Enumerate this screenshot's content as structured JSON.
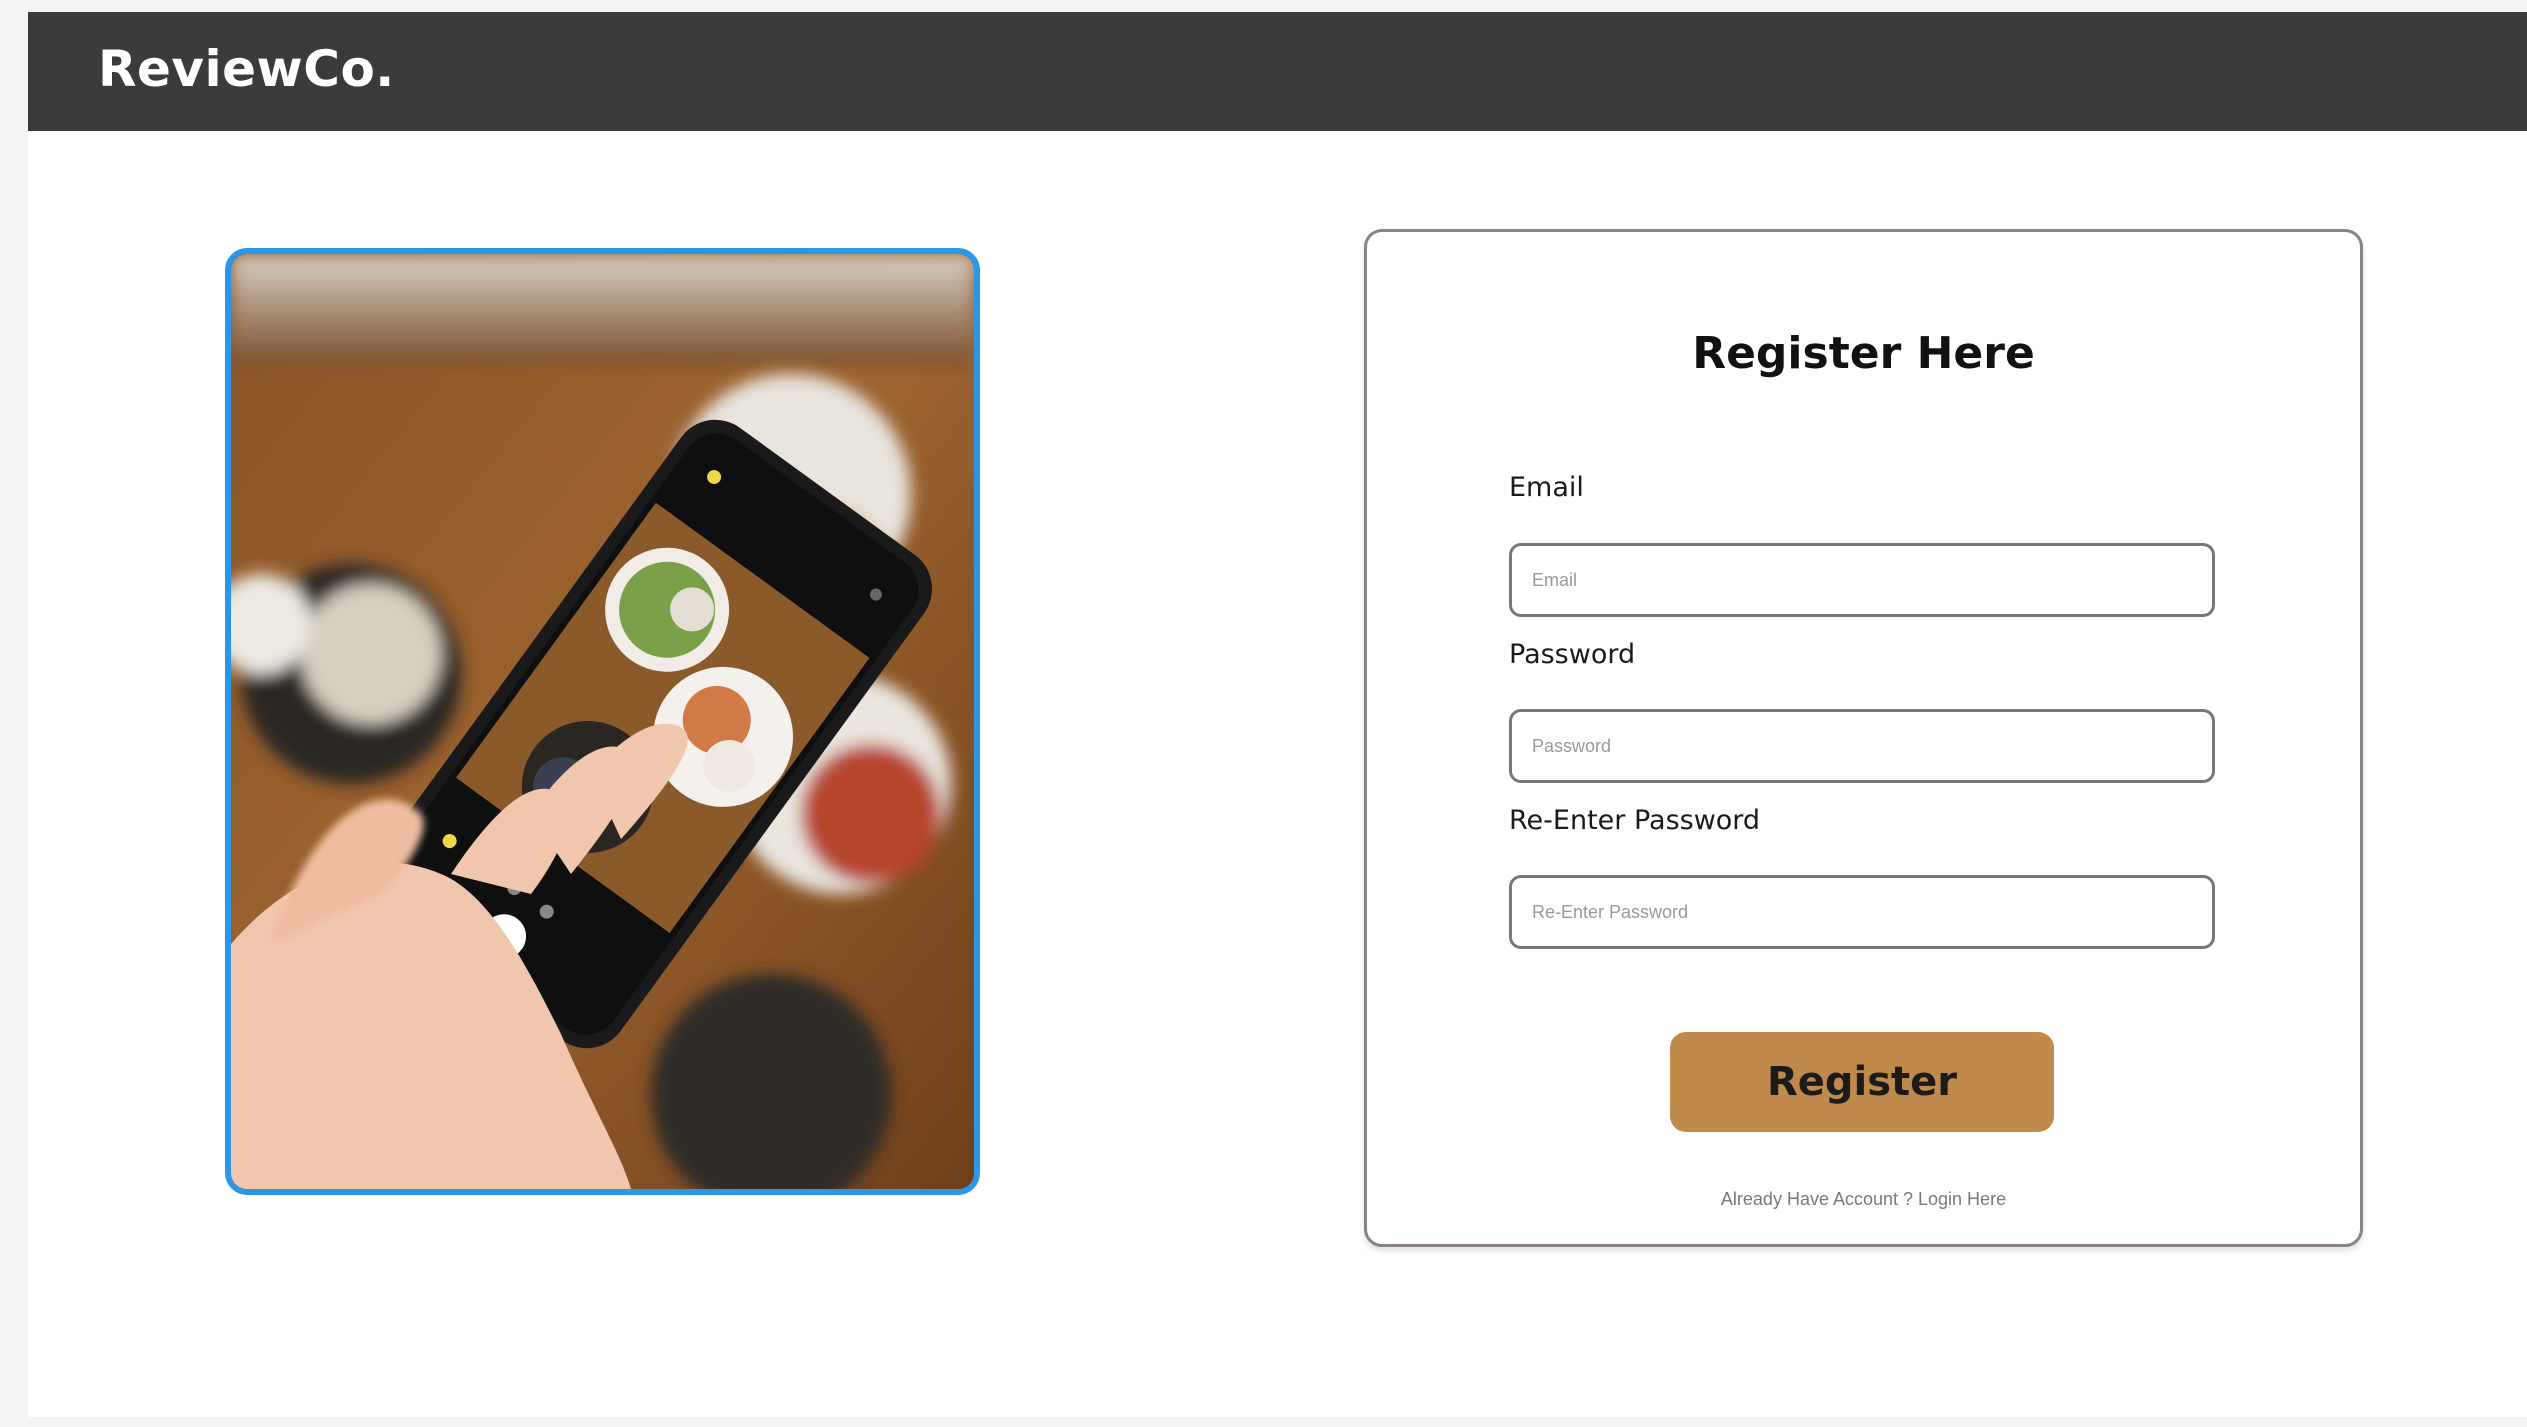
{
  "header": {
    "brand": "ReviewCo."
  },
  "form": {
    "title": "Register Here",
    "email": {
      "label": "Email",
      "placeholder": "Email",
      "value": ""
    },
    "password": {
      "label": "Password",
      "placeholder": "Password",
      "value": ""
    },
    "confirm_password": {
      "label": "Re-Enter Password",
      "placeholder": "Re-Enter Password",
      "value": ""
    },
    "submit_label": "Register",
    "login_prompt": "Already Have Account ? Login Here"
  },
  "colors": {
    "navbar": "#3b3b3b",
    "photo_border": "#2b97e8",
    "button": "#c08a4c"
  },
  "hero_image": {
    "icon": "phone-photographing-food-image"
  }
}
